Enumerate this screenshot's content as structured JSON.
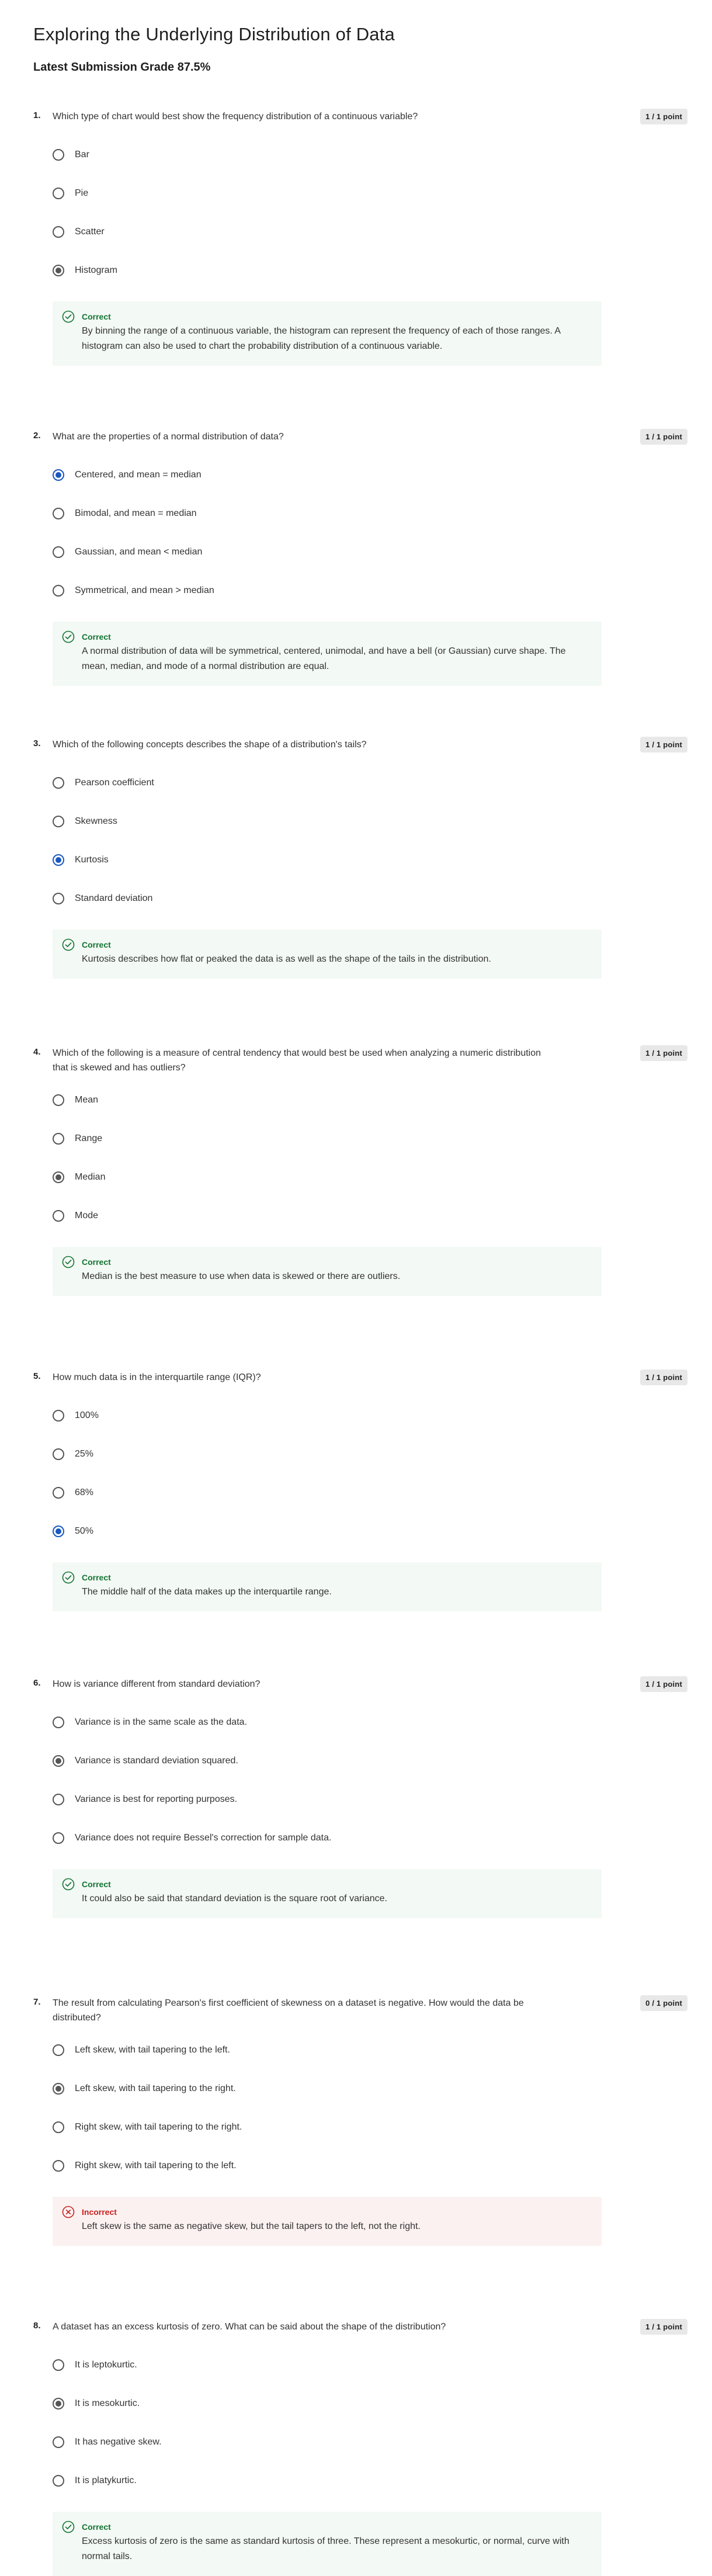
{
  "page": {
    "title": "Exploring the Underlying Distribution of Data",
    "grade": "Latest Submission Grade 87.5%"
  },
  "questions": [
    {
      "number": "1.",
      "text": "Which type of chart would best show the frequency distribution of a continuous variable?",
      "points": "1 / 1 point",
      "options": [
        "Bar",
        "Pie",
        "Scatter",
        "Histogram"
      ],
      "selected": 3,
      "selected_style": "gray",
      "feedback": {
        "status": "Correct",
        "correct": true,
        "text": "By binning the range of a continuous variable, the histogram can represent the frequency of each of those ranges. A histogram can also be used to chart the probability distribution of a continuous variable."
      }
    },
    {
      "number": "2.",
      "text": "What are the properties of a normal distribution of data?",
      "points": "1 / 1 point",
      "options": [
        "Centered, and mean = median",
        "Bimodal, and mean = median",
        "Gaussian, and mean < median",
        "Symmetrical, and mean > median"
      ],
      "selected": 0,
      "selected_style": "blue",
      "feedback": {
        "status": "Correct",
        "correct": true,
        "text": "A normal distribution of data will be symmetrical, centered, unimodal, and have a bell (or Gaussian) curve shape. The mean, median, and mode of a normal distribution are equal."
      }
    },
    {
      "number": "3.",
      "text": "Which of the following concepts describes the shape of a distribution's tails?",
      "points": "1 / 1 point",
      "options": [
        "Pearson coefficient",
        "Skewness",
        "Kurtosis",
        "Standard deviation"
      ],
      "selected": 2,
      "selected_style": "blue",
      "feedback": {
        "status": "Correct",
        "correct": true,
        "text": "Kurtosis describes how flat or peaked the data is as well as the shape of the tails in the distribution."
      }
    },
    {
      "number": "4.",
      "text": "Which of the following is a measure of central tendency that would best be used when analyzing a numeric distribution that is skewed and has outliers?",
      "points": "1 / 1 point",
      "options": [
        "Mean",
        "Range",
        "Median",
        "Mode"
      ],
      "selected": 2,
      "selected_style": "gray",
      "feedback": {
        "status": "Correct",
        "correct": true,
        "text": "Median is the best measure to use when data is skewed or there are outliers."
      }
    },
    {
      "number": "5.",
      "text": "How much data is in the interquartile range (IQR)?",
      "points": "1 / 1 point",
      "options": [
        "100%",
        "25%",
        "68%",
        "50%"
      ],
      "selected": 3,
      "selected_style": "blue",
      "feedback": {
        "status": "Correct",
        "correct": true,
        "text": "The middle half of the data makes up the interquartile range."
      }
    },
    {
      "number": "6.",
      "text": "How is variance different from standard deviation?",
      "points": "1 / 1 point",
      "options": [
        "Variance is in the same scale as the data.",
        "Variance is standard deviation squared.",
        "Variance is best for reporting purposes.",
        "Variance does not require Bessel's correction for sample data."
      ],
      "selected": 1,
      "selected_style": "gray",
      "feedback": {
        "status": "Correct",
        "correct": true,
        "text": "It could also be said that standard deviation is the square root of variance."
      }
    },
    {
      "number": "7.",
      "text": "The result from calculating Pearson's first coefficient of skewness on a dataset is negative. How would the data be distributed?",
      "points": "0 / 1 point",
      "options": [
        "Left skew, with tail tapering to the left.",
        "Left skew, with tail tapering to the right.",
        "Right skew, with tail tapering to the right.",
        "Right skew, with tail tapering to the left."
      ],
      "selected": 1,
      "selected_style": "gray",
      "feedback": {
        "status": "Incorrect",
        "correct": false,
        "text": "Left skew is the same as negative skew, but the tail tapers to the left, not the right."
      }
    },
    {
      "number": "8.",
      "text": "A dataset has an excess kurtosis of zero. What can be said about the shape of the distribution?",
      "points": "1 / 1 point",
      "options": [
        "It is leptokurtic.",
        "It is mesokurtic.",
        "It has negative skew.",
        "It is platykurtic."
      ],
      "selected": 1,
      "selected_style": "gray",
      "feedback": {
        "status": "Correct",
        "correct": true,
        "text": "Excess kurtosis of zero is the same as standard kurtosis of three. These represent a mesokurtic, or normal, curve with normal tails."
      }
    }
  ],
  "colors": {
    "correct": "#137333",
    "incorrect": "#c5221f",
    "correct_bg": "#f3f9f4",
    "incorrect_bg": "#fcf1f1",
    "selected_blue": "#1958c2",
    "badge_bg": "#e8e8e8"
  },
  "icons": {
    "correct": "check-circle-icon",
    "incorrect": "x-circle-icon"
  }
}
